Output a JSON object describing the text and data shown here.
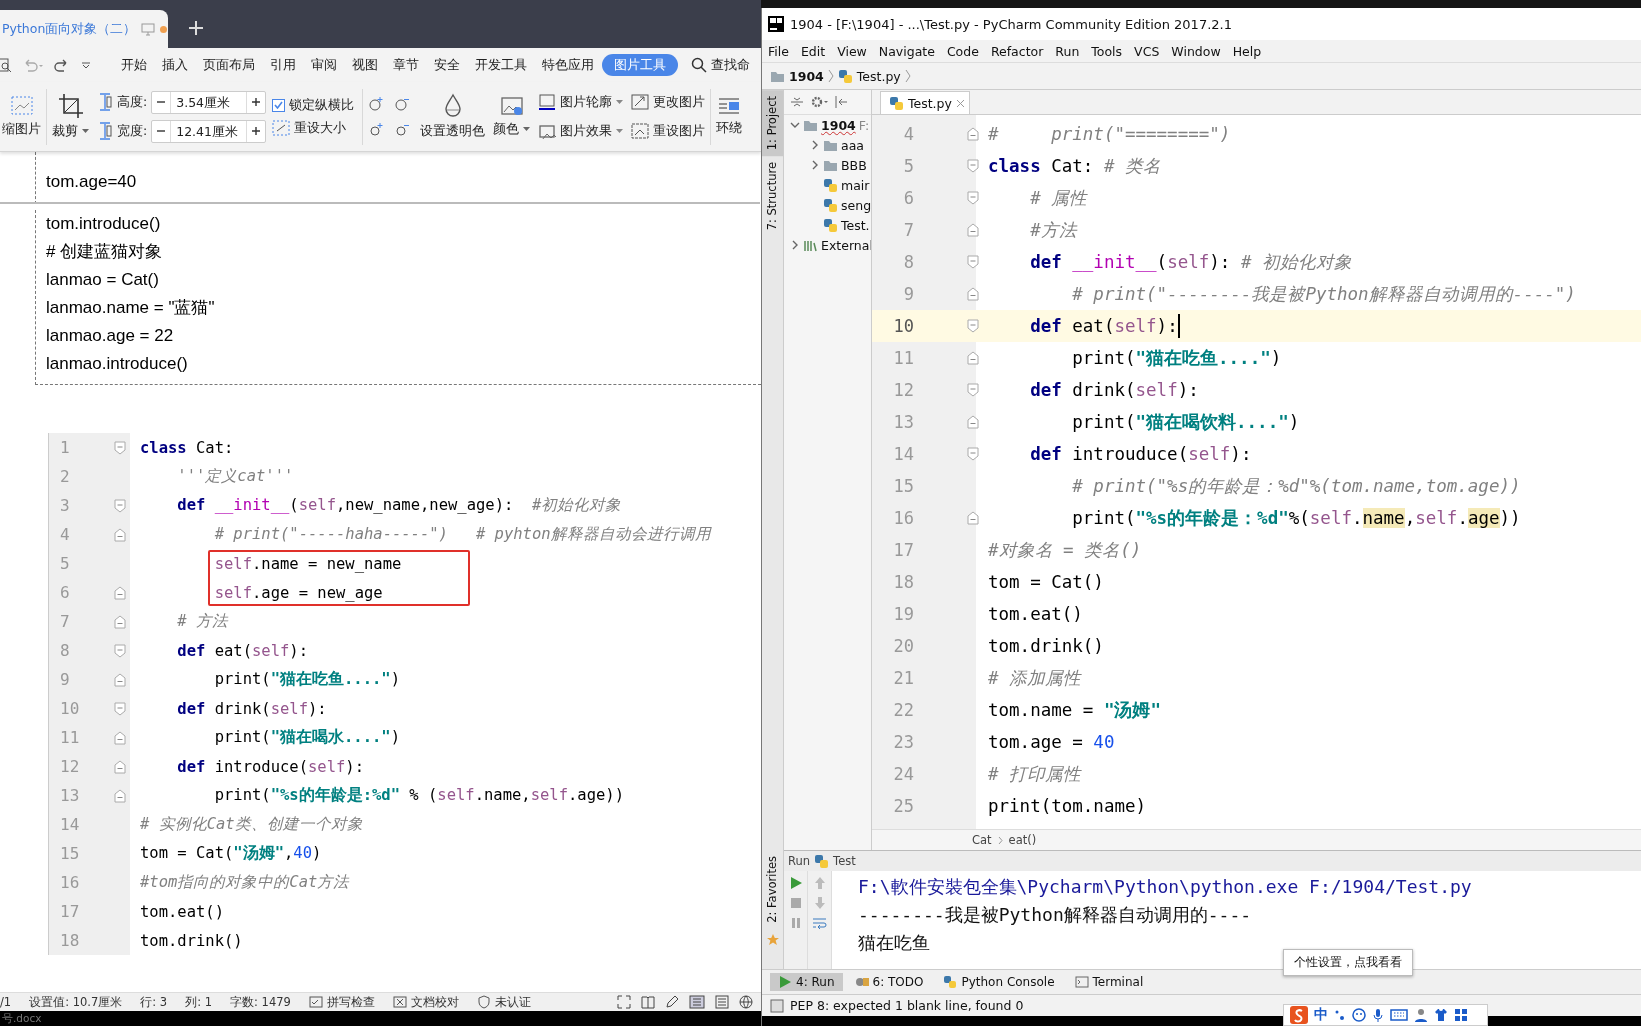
{
  "wps": {
    "doc_tab": {
      "title": "Python面向对象（二）",
      "modified": true
    },
    "ribbon": [
      {
        "label": "开始",
        "selected": false
      },
      {
        "label": "插入",
        "selected": false
      },
      {
        "label": "页面布局",
        "selected": false
      },
      {
        "label": "引用",
        "selected": false
      },
      {
        "label": "审阅",
        "selected": false
      },
      {
        "label": "视图",
        "selected": false
      },
      {
        "label": "章节",
        "selected": false
      },
      {
        "label": "安全",
        "selected": false
      },
      {
        "label": "开发工具",
        "selected": false
      },
      {
        "label": "特色应用",
        "selected": false
      },
      {
        "label": "图片工具",
        "selected": true
      }
    ],
    "search": "查找命",
    "tools": {
      "compress": "缩图片",
      "crop": "裁剪",
      "height": {
        "label": "高度:",
        "value": "3.54厘米"
      },
      "width": {
        "label": "宽度:",
        "value": "12.41厘米"
      },
      "lock_ratio": {
        "label": "锁定纵横比",
        "checked": true
      },
      "reset_size": "重设大小",
      "transparent": "设置透明色",
      "color_label": "颜色",
      "outline": "图片轮廓",
      "effect": "图片效果",
      "change": "更改图片",
      "reset_picture": "重设图片",
      "wrap": "环绕"
    },
    "doc_lines": [
      {
        "text": "tom.age=40",
        "page_break_after": true
      },
      {
        "text": "tom.introduce()",
        "page_break_after": false
      },
      {
        "text": "#  创建蓝猫对象",
        "page_break_after": false
      },
      {
        "text": "lanmao = Cat()",
        "page_break_after": false
      },
      {
        "text": "lanmao.name = \"蓝猫\"",
        "page_break_after": false
      },
      {
        "text": "lanmao.age = 22",
        "page_break_after": false
      },
      {
        "text": "lanmao.introduce()",
        "page_break_after": false
      }
    ],
    "code": [
      {
        "number": "1",
        "fold_start": true,
        "fold_end": false,
        "marked": false,
        "tokens": [
          {
            "kind": "kw",
            "text": "class"
          },
          {
            "kind": "pl",
            "text": " Cat:"
          }
        ]
      },
      {
        "number": "2",
        "fold_start": false,
        "fold_end": false,
        "marked": false,
        "tokens": [
          {
            "kind": "cm",
            "text": "    '''定义cat'''"
          }
        ]
      },
      {
        "number": "3",
        "fold_start": true,
        "fold_end": false,
        "marked": false,
        "tokens": [
          {
            "kind": "kw",
            "text": "    def"
          },
          {
            "kind": "fn",
            "text": " __init__"
          },
          {
            "kind": "pl",
            "text": "("
          },
          {
            "kind": "self",
            "text": "self"
          },
          {
            "kind": "pl",
            "text": ",new_name,new_age):  "
          },
          {
            "kind": "cm",
            "text": "#初始化对象"
          }
        ]
      },
      {
        "number": "4",
        "fold_start": false,
        "fold_end": true,
        "marked": false,
        "tokens": [
          {
            "kind": "cm",
            "text": "        # print(\"-----haha-----\")   # pyhton解释器自动会进行调用"
          }
        ]
      },
      {
        "number": "5",
        "fold_start": false,
        "fold_end": false,
        "marked": true,
        "tokens": [
          {
            "kind": "self",
            "text": "        self"
          },
          {
            "kind": "pl",
            "text": ".name = new_name"
          }
        ]
      },
      {
        "number": "6",
        "fold_start": false,
        "fold_end": true,
        "marked": true,
        "tokens": [
          {
            "kind": "self",
            "text": "        self"
          },
          {
            "kind": "pl",
            "text": ".age = new_age"
          }
        ]
      },
      {
        "number": "7",
        "fold_start": false,
        "fold_end": true,
        "marked": false,
        "tokens": [
          {
            "kind": "cm",
            "text": "    # 方法"
          }
        ]
      },
      {
        "number": "8",
        "fold_start": true,
        "fold_end": false,
        "marked": false,
        "tokens": [
          {
            "kind": "kw",
            "text": "    def"
          },
          {
            "kind": "pl",
            "text": " eat("
          },
          {
            "kind": "self",
            "text": "self"
          },
          {
            "kind": "pl",
            "text": "):"
          }
        ]
      },
      {
        "number": "9",
        "fold_start": false,
        "fold_end": true,
        "marked": false,
        "tokens": [
          {
            "kind": "pl",
            "text": "        print("
          },
          {
            "kind": "str",
            "text": "\"猫在吃鱼....\""
          },
          {
            "kind": "pl",
            "text": ")"
          }
        ]
      },
      {
        "number": "10",
        "fold_start": true,
        "fold_end": false,
        "marked": false,
        "tokens": [
          {
            "kind": "kw",
            "text": "    def"
          },
          {
            "kind": "pl",
            "text": " drink("
          },
          {
            "kind": "self",
            "text": "self"
          },
          {
            "kind": "pl",
            "text": "):"
          }
        ]
      },
      {
        "number": "11",
        "fold_start": false,
        "fold_end": true,
        "marked": false,
        "tokens": [
          {
            "kind": "pl",
            "text": "        print("
          },
          {
            "kind": "str",
            "text": "\"猫在喝水....\""
          },
          {
            "kind": "pl",
            "text": ")"
          }
        ]
      },
      {
        "number": "12",
        "fold_start": false,
        "fold_end": true,
        "marked": false,
        "tokens": [
          {
            "kind": "kw",
            "text": "    def"
          },
          {
            "kind": "pl",
            "text": " introduce("
          },
          {
            "kind": "self",
            "text": "self"
          },
          {
            "kind": "pl",
            "text": "):"
          }
        ]
      },
      {
        "number": "13",
        "fold_start": false,
        "fold_end": true,
        "marked": false,
        "tokens": [
          {
            "kind": "pl",
            "text": "        print("
          },
          {
            "kind": "str",
            "text": "\"%s的年龄是:%d\""
          },
          {
            "kind": "pl",
            "text": " % ("
          },
          {
            "kind": "self",
            "text": "self"
          },
          {
            "kind": "pl",
            "text": ".name,"
          },
          {
            "kind": "self",
            "text": "self"
          },
          {
            "kind": "pl",
            "text": ".age))"
          }
        ]
      },
      {
        "number": "14",
        "fold_start": false,
        "fold_end": false,
        "marked": false,
        "tokens": [
          {
            "kind": "cm",
            "text": "# 实例化Cat类、创建一个对象"
          }
        ]
      },
      {
        "number": "15",
        "fold_start": false,
        "fold_end": false,
        "marked": false,
        "tokens": [
          {
            "kind": "pl",
            "text": "tom = Cat("
          },
          {
            "kind": "str",
            "text": "\"汤姆\""
          },
          {
            "kind": "pl",
            "text": ","
          },
          {
            "kind": "num",
            "text": "40"
          },
          {
            "kind": "pl",
            "text": ")"
          }
        ]
      },
      {
        "number": "16",
        "fold_start": false,
        "fold_end": false,
        "marked": false,
        "tokens": [
          {
            "kind": "cm",
            "text": "#tom指向的对象中的Cat方法"
          }
        ]
      },
      {
        "number": "17",
        "fold_start": false,
        "fold_end": false,
        "marked": false,
        "tokens": [
          {
            "kind": "pl",
            "text": "tom.eat()"
          }
        ]
      },
      {
        "number": "18",
        "fold_start": false,
        "fold_end": false,
        "marked": false,
        "tokens": [
          {
            "kind": "pl",
            "text": "tom.drink()"
          }
        ]
      }
    ],
    "status": [
      {
        "kind": "plain",
        "text": "/1"
      },
      {
        "kind": "plain",
        "text": "设置值: 10.7厘米"
      },
      {
        "kind": "plain",
        "text": "行: 3"
      },
      {
        "kind": "plain",
        "text": "列: 1"
      },
      {
        "kind": "plain",
        "text": "字数: 1479"
      },
      {
        "kind": "spell",
        "text": "拼写检查"
      },
      {
        "kind": "proof",
        "text": "文档校对"
      },
      {
        "kind": "cert",
        "text": "未认证"
      }
    ],
    "taskbar_file": "号.docx"
  },
  "pycharm": {
    "title": "1904 - [F:\\1904] - ...\\Test.py - PyCharm Community Edition 2017.2.1",
    "menu": [
      "File",
      "Edit",
      "View",
      "Navigate",
      "Code",
      "Refactor",
      "Run",
      "Tools",
      "VCS",
      "Window",
      "Help"
    ],
    "breadcrumb": [
      "1904",
      "Test.py"
    ],
    "side_tabs": [
      {
        "label": "1: Project",
        "selected": true
      },
      {
        "label": "7: Structure",
        "selected": false
      }
    ],
    "favorites_tab": "2: Favorites",
    "tree": [
      {
        "label": "1904",
        "suffix": "F:",
        "kind": "folder",
        "expanded": true,
        "children": [
          {
            "label": "aaa",
            "kind": "folder",
            "expanded": false
          },
          {
            "label": "BBB",
            "kind": "folder",
            "expanded": false
          },
          {
            "label": "mair",
            "kind": "file"
          },
          {
            "label": "seng",
            "kind": "file"
          },
          {
            "label": "Test.",
            "kind": "file"
          }
        ]
      },
      {
        "label": "External",
        "kind": "library",
        "expanded": false
      }
    ],
    "editor_tab": "Test.py",
    "lines": [
      {
        "number": "4",
        "fold_start": false,
        "fold_end": true,
        "current": false,
        "tokens": [
          {
            "kind": "cm",
            "text": "#     print(\"========\")"
          }
        ]
      },
      {
        "number": "5",
        "fold_start": true,
        "fold_end": false,
        "current": false,
        "tokens": [
          {
            "kind": "kw",
            "text": "class"
          },
          {
            "kind": "pl",
            "text": " Cat: "
          },
          {
            "kind": "cm",
            "text": "# 类名"
          }
        ]
      },
      {
        "number": "6",
        "fold_start": true,
        "fold_end": false,
        "current": false,
        "tokens": [
          {
            "kind": "cm",
            "text": "    # 属性"
          }
        ]
      },
      {
        "number": "7",
        "fold_start": false,
        "fold_end": true,
        "current": false,
        "tokens": [
          {
            "kind": "cm",
            "text": "    #方法"
          }
        ]
      },
      {
        "number": "8",
        "fold_start": true,
        "fold_end": false,
        "current": false,
        "tokens": [
          {
            "kind": "kw",
            "text": "    def"
          },
          {
            "kind": "fn",
            "text": " __init__"
          },
          {
            "kind": "pl",
            "text": "("
          },
          {
            "kind": "self",
            "text": "self"
          },
          {
            "kind": "pl",
            "text": "): "
          },
          {
            "kind": "cm",
            "text": "# 初始化对象"
          }
        ]
      },
      {
        "number": "9",
        "fold_start": false,
        "fold_end": true,
        "current": false,
        "tokens": [
          {
            "kind": "cm",
            "text": "        # print(\"--------我是被Python解释器自动调用的----\")"
          }
        ]
      },
      {
        "number": "10",
        "fold_start": true,
        "fold_end": false,
        "current": true,
        "tokens": [
          {
            "kind": "kw",
            "text": "    def"
          },
          {
            "kind": "pl",
            "text": " eat("
          },
          {
            "kind": "self",
            "text": "self"
          },
          {
            "kind": "pl",
            "text": "):"
          }
        ]
      },
      {
        "number": "11",
        "fold_start": false,
        "fold_end": true,
        "current": false,
        "tokens": [
          {
            "kind": "pl",
            "text": "        print("
          },
          {
            "kind": "str",
            "text": "\"猫在吃鱼....\""
          },
          {
            "kind": "pl",
            "text": ")"
          }
        ]
      },
      {
        "number": "12",
        "fold_start": true,
        "fold_end": false,
        "current": false,
        "tokens": [
          {
            "kind": "kw",
            "text": "    def"
          },
          {
            "kind": "pl",
            "text": " drink("
          },
          {
            "kind": "self",
            "text": "self"
          },
          {
            "kind": "pl",
            "text": "):"
          }
        ]
      },
      {
        "number": "13",
        "fold_start": false,
        "fold_end": true,
        "current": false,
        "tokens": [
          {
            "kind": "pl",
            "text": "        print("
          },
          {
            "kind": "str",
            "text": "\"猫在喝饮料....\""
          },
          {
            "kind": "pl",
            "text": ")"
          }
        ]
      },
      {
        "number": "14",
        "fold_start": true,
        "fold_end": false,
        "current": false,
        "tokens": [
          {
            "kind": "kw",
            "text": "    def"
          },
          {
            "kind": "pl",
            "text": " introuduce("
          },
          {
            "kind": "self",
            "text": "self"
          },
          {
            "kind": "pl",
            "text": "):"
          }
        ]
      },
      {
        "number": "15",
        "fold_start": false,
        "fold_end": false,
        "current": false,
        "tokens": [
          {
            "kind": "cm",
            "text": "        # print(\"%s的年龄是：%d\"%(tom.name,tom.age))"
          }
        ]
      },
      {
        "number": "16",
        "fold_start": false,
        "fold_end": true,
        "current": false,
        "tokens": [
          {
            "kind": "pl",
            "text": "        print("
          },
          {
            "kind": "str",
            "text": "\"%s的年龄是：%d\""
          },
          {
            "kind": "pl",
            "text": "%("
          },
          {
            "kind": "self",
            "text": "self"
          },
          {
            "kind": "pl",
            "text": "."
          },
          {
            "kind": "hl",
            "text": "name"
          },
          {
            "kind": "pl",
            "text": ","
          },
          {
            "kind": "self",
            "text": "self"
          },
          {
            "kind": "pl",
            "text": "."
          },
          {
            "kind": "hl",
            "text": "age"
          },
          {
            "kind": "pl",
            "text": "))"
          }
        ]
      },
      {
        "number": "17",
        "fold_start": false,
        "fold_end": false,
        "current": false,
        "tokens": [
          {
            "kind": "cm",
            "text": "#对象名 = 类名()"
          }
        ]
      },
      {
        "number": "18",
        "fold_start": false,
        "fold_end": false,
        "current": false,
        "tokens": [
          {
            "kind": "pl",
            "text": "tom = Cat()"
          }
        ]
      },
      {
        "number": "19",
        "fold_start": false,
        "fold_end": false,
        "current": false,
        "tokens": [
          {
            "kind": "pl",
            "text": "tom.eat()"
          }
        ]
      },
      {
        "number": "20",
        "fold_start": false,
        "fold_end": false,
        "current": false,
        "tokens": [
          {
            "kind": "pl",
            "text": "tom.drink()"
          }
        ]
      },
      {
        "number": "21",
        "fold_start": false,
        "fold_end": false,
        "current": false,
        "tokens": [
          {
            "kind": "cm",
            "text": "# 添加属性"
          }
        ]
      },
      {
        "number": "22",
        "fold_start": false,
        "fold_end": false,
        "current": false,
        "tokens": [
          {
            "kind": "pl",
            "text": "tom.name = "
          },
          {
            "kind": "str",
            "text": "\"汤姆\""
          }
        ]
      },
      {
        "number": "23",
        "fold_start": false,
        "fold_end": false,
        "current": false,
        "tokens": [
          {
            "kind": "pl",
            "text": "tom.age = "
          },
          {
            "kind": "num",
            "text": "40"
          }
        ]
      },
      {
        "number": "24",
        "fold_start": false,
        "fold_end": false,
        "current": false,
        "tokens": [
          {
            "kind": "cm",
            "text": "# 打印属性"
          }
        ]
      },
      {
        "number": "25",
        "fold_start": false,
        "fold_end": false,
        "current": false,
        "tokens": [
          {
            "kind": "pl",
            "text": "print(tom.name)"
          }
        ]
      }
    ],
    "code_path": [
      "Cat",
      "eat()"
    ],
    "run": {
      "label": "Run",
      "config": "Test",
      "output": [
        {
          "kind": "cmd",
          "text": "F:\\軟件安裝包全集\\Pycharm\\Python\\python.exe F:/1904/Test.py"
        },
        {
          "kind": "out",
          "text": "--------我是被Python解释器自动调用的----"
        },
        {
          "kind": "out",
          "text": "猫在吃鱼"
        }
      ]
    },
    "bottom_tabs": [
      {
        "label": "4: Run",
        "kind": "run",
        "selected": true
      },
      {
        "label": "6: TODO",
        "kind": "todo",
        "selected": false
      },
      {
        "label": "Python Console",
        "kind": "console",
        "selected": false
      },
      {
        "label": "Terminal",
        "kind": "terminal",
        "selected": false
      }
    ],
    "status": "PEP 8: expected 1 blank line, found 0",
    "tooltip": "个性设置，点我看看",
    "ime": "中"
  }
}
